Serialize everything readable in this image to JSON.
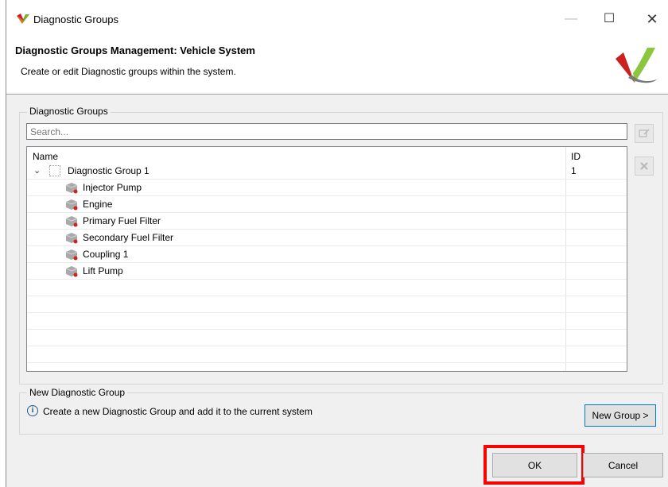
{
  "window": {
    "title": "Diagnostic Groups",
    "minimize_glyph": "—",
    "maximize_glyph": "☐",
    "close_glyph": "✕"
  },
  "header": {
    "title": "Diagnostic Groups Management: Vehicle System",
    "description": "Create or edit Diagnostic groups within the system."
  },
  "groups_panel": {
    "legend": "Diagnostic Groups",
    "search": {
      "value": "",
      "placeholder": "Search..."
    },
    "columns": {
      "name": "Name",
      "id": "ID"
    },
    "tree": {
      "group": {
        "label": "Diagnostic Group 1",
        "id": "1",
        "expanded": true,
        "checked": false
      },
      "children": [
        {
          "label": "Injector Pump",
          "icon": "component-icon"
        },
        {
          "label": "Engine",
          "icon": "component-icon"
        },
        {
          "label": "Primary Fuel Filter",
          "icon": "component-icon"
        },
        {
          "label": "Secondary Fuel Filter",
          "icon": "component-icon"
        },
        {
          "label": "Coupling 1",
          "icon": "component-icon"
        },
        {
          "label": "Lift Pump",
          "icon": "component-icon"
        }
      ]
    },
    "side_buttons": [
      {
        "icon": "edit-icon",
        "enabled": false
      },
      {
        "icon": "delete-icon",
        "enabled": false
      }
    ]
  },
  "new_group_panel": {
    "legend": "New Diagnostic Group",
    "info_glyph": "i",
    "info_text": "Create a new Diagnostic Group and add it to the current system",
    "button_label": "New Group >"
  },
  "footer": {
    "ok_label": "OK",
    "cancel_label": "Cancel",
    "highlight_color": "#ff0000"
  }
}
